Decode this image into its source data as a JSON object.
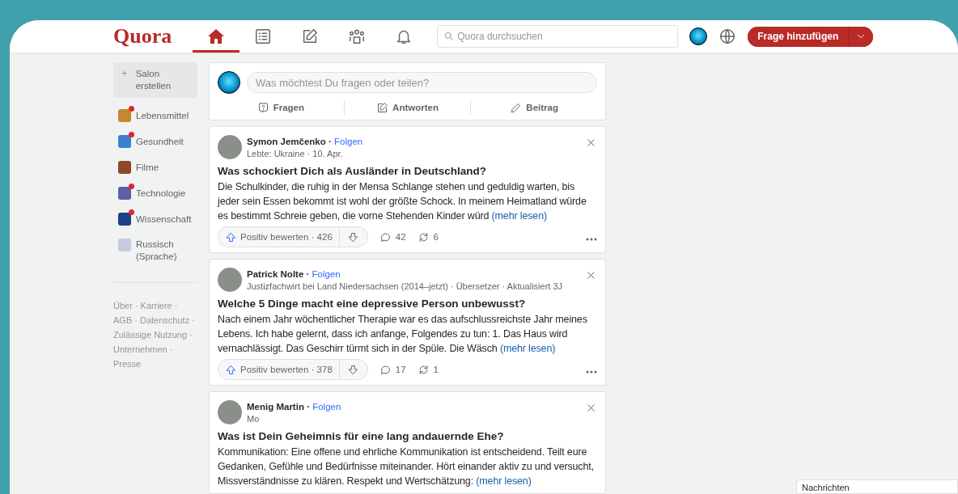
{
  "header": {
    "logo": "Quora",
    "nav": [
      {
        "kind": "home",
        "selected": true
      },
      {
        "kind": "list",
        "selected": false
      },
      {
        "kind": "edit",
        "selected": false
      },
      {
        "kind": "people",
        "selected": false
      },
      {
        "kind": "bell",
        "selected": false
      }
    ],
    "search": {
      "placeholder": "Quora durchsuchen"
    },
    "add_button": "Frage hinzufügen"
  },
  "sidebar": {
    "create_icon": "+",
    "create": "Salon erstellen",
    "items": [
      {
        "label": "Lebensmittel",
        "color": "#c9862f",
        "unread": true
      },
      {
        "label": "Gesundheit",
        "color": "#3f7fd1",
        "unread": true
      },
      {
        "label": "Filme",
        "color": "#8a4a2a",
        "unread": false
      },
      {
        "label": "Technologie",
        "color": "#5c5fa8",
        "unread": true
      },
      {
        "label": "Wissenschaft",
        "color": "#1d3f8a",
        "unread": true
      },
      {
        "label": "Russisch (Sprache)",
        "color": "#c7cbe0",
        "unread": false
      }
    ],
    "footer": "Über · Karriere · AGB · Datenschutz · Zulässige Nutzung · Unternehmen · Presse"
  },
  "composer": {
    "placeholder": "Was möchtest Du fragen oder teilen?",
    "actions": [
      {
        "kind": "ask",
        "label": "Fragen"
      },
      {
        "kind": "answer",
        "label": "Antworten"
      },
      {
        "kind": "post",
        "label": "Beitrag"
      }
    ]
  },
  "posts": [
    {
      "author": "Symon Jemčenko",
      "sep": "·",
      "follow": "Folgen",
      "meta": "Lebte: Ukraine · 10. Apr.",
      "title": "Was schockiert Dich als Ausländer in Deutschland?",
      "body": "Die Schulkinder, die ruhig in der Mensa Schlange stehen und geduldig warten, bis jeder sein Essen bekommt ist wohl der größte Schock. In meinem Heimatland würde es bestimmt Schreie geben, die vorne Stehenden Kinder würd",
      "more": "(mehr lesen)",
      "upvote": "Positiv bewerten · 426",
      "comments": "42",
      "shares": "6"
    },
    {
      "author": "Patrick Nolte",
      "sep": "·",
      "follow": "Folgen",
      "meta": "Justizfachwirt bei Land Niedersachsen (2014–jetzt) · Übersetzer · Aktualisiert 3J",
      "title": "Welche 5 Dinge macht eine depressive Person unbewusst?",
      "body": "Nach einem Jahr wöchentlicher Therapie war es das aufschlussreichste Jahr meines Lebens. Ich habe gelernt, dass ich anfange, Folgendes zu tun: 1. Das Haus wird vernachlässigt. Das Geschirr türmt sich in der Spüle. Die Wäsch",
      "more": "(mehr lesen)",
      "upvote": "Positiv bewerten · 378",
      "comments": "17",
      "shares": "1"
    },
    {
      "author": "Menig Martin",
      "sep": "·",
      "follow": "Folgen",
      "meta": "Mo",
      "title": "Was ist Dein Geheimnis für eine lang andauernde Ehe?",
      "body": "Kommunikation: Eine offene und ehrliche Kommunikation ist entscheidend. Teilt eure Gedanken, Gefühle und Bedürfnisse miteinander. Hört einander aktiv zu und versucht, Missverständnisse zu klären. Respekt und Wertschätzung:",
      "more": "(mehr lesen)"
    }
  ],
  "messages": {
    "title": "Nachrichten"
  }
}
